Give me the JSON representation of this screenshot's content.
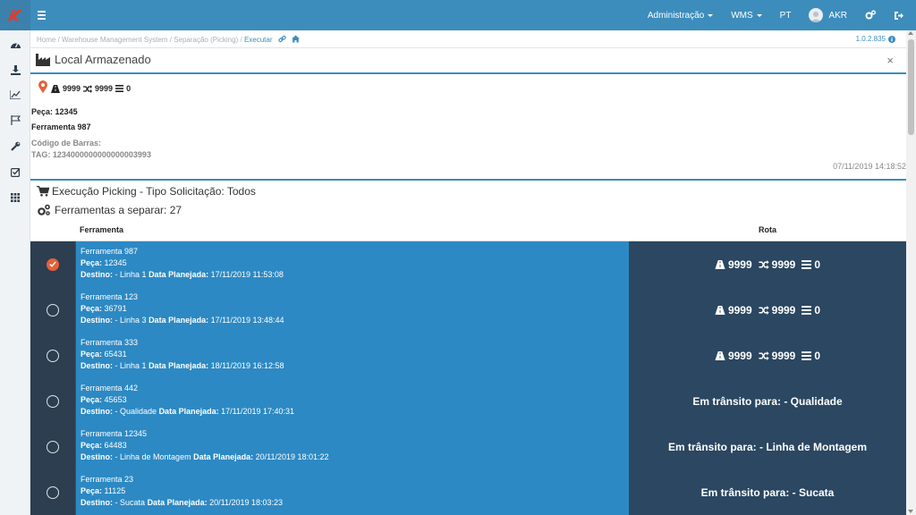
{
  "topbar": {
    "brand_color": "#3c8dbc",
    "menu": [
      {
        "label": "Administração",
        "has_caret": true
      },
      {
        "label": "WMS",
        "has_caret": true
      },
      {
        "label": "PT",
        "has_caret": false
      }
    ],
    "user": "AKR"
  },
  "sidebar": {
    "icons": [
      "dashboard-icon",
      "download-icon",
      "line-chart-icon",
      "flag-icon",
      "wrench-icon",
      "checkbox-icon",
      "grid-icon"
    ]
  },
  "breadcrumb": {
    "home": "Home",
    "wms": "Warehouse Management System",
    "picking": "Separação (Picking)",
    "current": "Executar",
    "sep": "/"
  },
  "version": "1.0.2.835",
  "panel": {
    "title": "Local Armazenado",
    "close": "×"
  },
  "location": {
    "road": "9999",
    "shuffle": "9999",
    "level": "0",
    "peca_label": "Peça:",
    "peca_value": "12345",
    "ferramenta": "Ferramenta 987",
    "barcode_label": "Código de Barras:",
    "tag": "TAG: 1234000000000000003993",
    "timestamp": "07/11/2019 14:18:52"
  },
  "picking": {
    "title": "Execução Picking - Tipo Solicitação: Todos",
    "count_label": "Ferramentas a separar: 27"
  },
  "table": {
    "headers": {
      "ferramenta": "Ferramenta",
      "rota": "Rota"
    },
    "labels": {
      "peca": "Peça:",
      "destino": "Destino:",
      "data": "Data Planejada:"
    },
    "rows": [
      {
        "checked": true,
        "name": "Ferramenta 987",
        "peca": "12345",
        "destino": "- Linha 1",
        "data": "17/11/2019 11:53:08",
        "route_type": "metrics",
        "r1": "9999",
        "r2": "9999",
        "r3": "0",
        "route_text": ""
      },
      {
        "checked": false,
        "name": "Ferramenta 123",
        "peca": "36791",
        "destino": "- Linha 3",
        "data": "17/11/2019 13:48:44",
        "route_type": "metrics",
        "r1": "9999",
        "r2": "9999",
        "r3": "0",
        "route_text": ""
      },
      {
        "checked": false,
        "name": "Ferramenta 333",
        "peca": "65431",
        "destino": "- Linha 1",
        "data": "18/11/2019 16:12:58",
        "route_type": "metrics",
        "r1": "9999",
        "r2": "9999",
        "r3": "0",
        "route_text": ""
      },
      {
        "checked": false,
        "name": "Ferramenta 442",
        "peca": "45653",
        "destino": "- Qualidade",
        "data": "17/11/2019 17:40:31",
        "route_type": "text",
        "r1": "",
        "r2": "",
        "r3": "",
        "route_text": "Em trânsito para: - Qualidade"
      },
      {
        "checked": false,
        "name": "Ferramenta 12345",
        "peca": "64483",
        "destino": "- Linha de Montagem",
        "data": "20/11/2019 18:01:22",
        "route_type": "text",
        "r1": "",
        "r2": "",
        "r3": "",
        "route_text": "Em trânsito para: - Linha de Montagem"
      },
      {
        "checked": false,
        "name": "Ferramenta 23",
        "peca": "11125",
        "destino": "- Sucata",
        "data": "20/11/2019 18:03:23",
        "route_type": "text",
        "r1": "",
        "r2": "",
        "r3": "",
        "route_text": "Em trânsito para: - Sucata"
      }
    ]
  }
}
